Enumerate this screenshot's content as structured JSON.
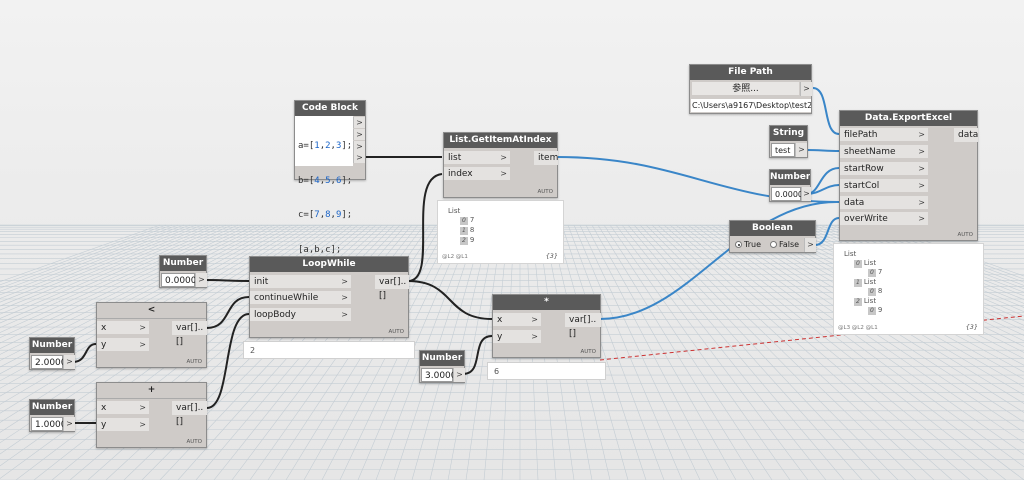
{
  "nodes": {
    "code_block": {
      "title": "Code Block",
      "lines": [
        "a=[1,2,3];",
        "b=[4,5,6];",
        "c=[7,8,9];",
        "[a,b,c];"
      ]
    },
    "list_get": {
      "title": "List.GetItemAtIndex",
      "in": [
        "list",
        "index"
      ],
      "out": "item",
      "auto": "AUTO"
    },
    "list_get_preview": {
      "header": "List",
      "items": [
        [
          "0",
          "7"
        ],
        [
          "1",
          "8"
        ],
        [
          "2",
          "9"
        ]
      ],
      "levels": "@L2 @L1",
      "count": "{3}"
    },
    "file_path": {
      "title": "File Path",
      "button": "参照...",
      "path": "C:\\Users\\a9167\\Desktop\\test2"
    },
    "string_node": {
      "title": "String",
      "value": "test"
    },
    "number_mid": {
      "title": "Number",
      "value": "0.0000"
    },
    "boolean_node": {
      "title": "Boolean",
      "true_label": "True",
      "false_label": "False"
    },
    "export": {
      "title": "Data.ExportExcel",
      "in": [
        "filePath",
        "sheetName",
        "startRow",
        "startCol",
        "data",
        "overWrite"
      ],
      "out": "data",
      "auto": "AUTO"
    },
    "export_preview": {
      "header": "List",
      "items": [
        [
          "0",
          "List",
          "0",
          "7"
        ],
        [
          "1",
          "List",
          "0",
          "8"
        ],
        [
          "2",
          "List",
          "0",
          "9"
        ]
      ],
      "levels": "@L3 @L2 @L1",
      "count": "{3}"
    },
    "number_loop": {
      "title": "Number",
      "value": "0.0000"
    },
    "loopwhile": {
      "title": "LoopWhile",
      "in": [
        "init",
        "continueWhile",
        "loopBody"
      ],
      "out": "var[]..[]",
      "auto": "AUTO",
      "preview": "2"
    },
    "less": {
      "title": "<",
      "in": [
        "x",
        "y"
      ],
      "out": "var[]..[]",
      "auto": "AUTO"
    },
    "number_two": {
      "title": "Number",
      "value": "2.0000"
    },
    "plus": {
      "title": "+",
      "in": [
        "x",
        "y"
      ],
      "out": "var[]..[]",
      "auto": "AUTO"
    },
    "number_one": {
      "title": "Number",
      "value": "1.0000"
    },
    "mult": {
      "title": "*",
      "in": [
        "x",
        "y"
      ],
      "out": "var[]..[]",
      "auto": "AUTO",
      "preview": "6"
    },
    "number_three": {
      "title": "Number",
      "value": "3.0000"
    }
  },
  "colors": {
    "node_header": "#5a5a5a",
    "node_body": "#cfcbc8",
    "wire_black": "#222222",
    "wire_blue": "#3a86c8",
    "wire_red_dashed": "#cc3333"
  }
}
